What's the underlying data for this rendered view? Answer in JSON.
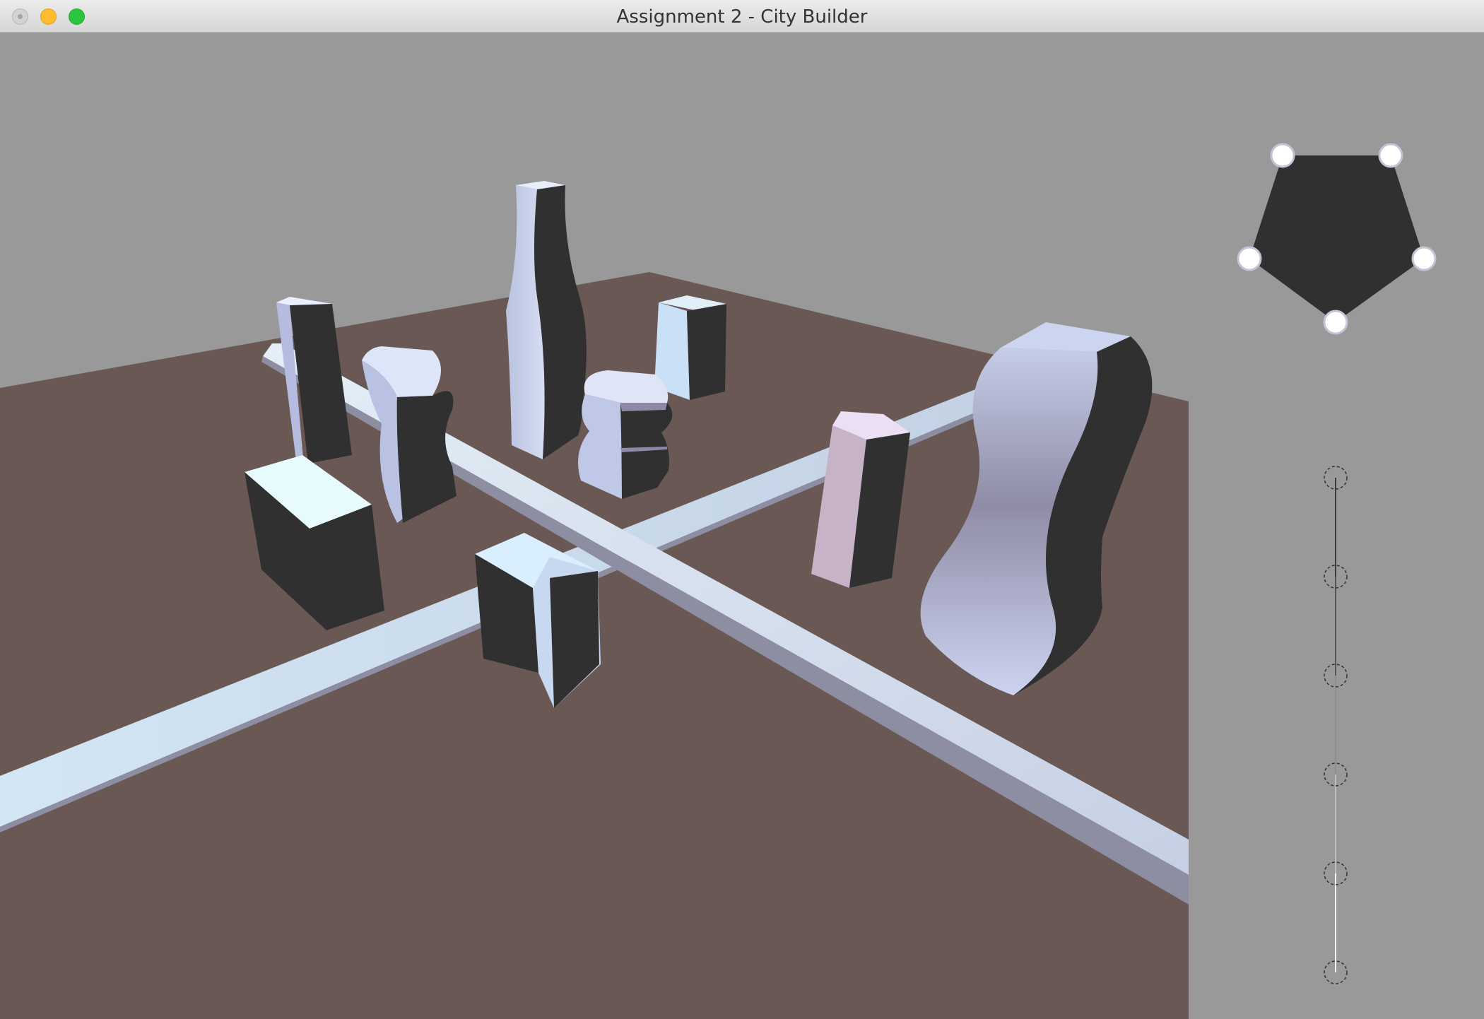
{
  "window": {
    "title": "Assignment 2 - City Builder",
    "controls": [
      "close",
      "minimize",
      "maximize"
    ]
  },
  "colors": {
    "sky": "#999999",
    "ground": "#6b5a56",
    "road": "#cbdcea",
    "building_lit": "#c9d3ee",
    "building_shadow": "#2f2f2f",
    "handle": "#ffffff",
    "profile_fill": "#303030"
  },
  "footprint_editor": {
    "shape": "pentagon",
    "vertex_count": 5
  },
  "height_profile_editor": {
    "control_point_count": 6
  }
}
